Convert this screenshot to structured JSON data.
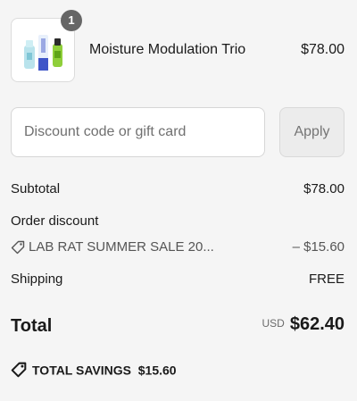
{
  "product": {
    "name": "Moisture Modulation Trio",
    "price": "$78.00",
    "quantity": "1",
    "image_icon": "product-bottles-image"
  },
  "discount": {
    "placeholder": "Discount code or gift card",
    "value": "",
    "apply_label": "Apply"
  },
  "summary": {
    "subtotal_label": "Subtotal",
    "subtotal_value": "$78.00",
    "order_discount_label": "Order discount",
    "discount_code": "LAB RAT SUMMER SALE 20...",
    "discount_value": "– $15.60",
    "shipping_label": "Shipping",
    "shipping_value": "FREE"
  },
  "total": {
    "label": "Total",
    "currency": "USD",
    "amount": "$62.40"
  },
  "savings": {
    "label": "TOTAL SAVINGS",
    "amount": "$15.60"
  },
  "colors": {
    "background": "#f5f5f5",
    "badge": "#666666",
    "text": "#1a1a1a",
    "muted": "#555555"
  }
}
